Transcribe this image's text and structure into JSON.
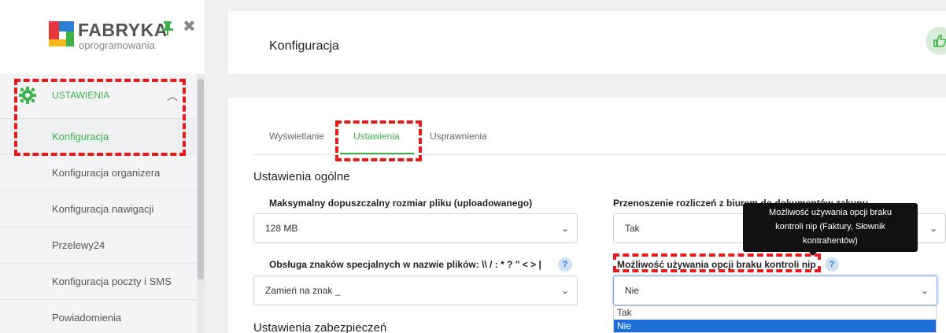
{
  "logo": {
    "title": "FABRYKA",
    "subtitle": "oprogramowania"
  },
  "sidebar": {
    "section_label": "USTAWIENIA",
    "items": [
      {
        "label": "Konfiguracja",
        "active": true
      },
      {
        "label": "Konfiguracja organizera"
      },
      {
        "label": "Konfiguracja nawigacji"
      },
      {
        "label": "Przelewy24"
      },
      {
        "label": "Konfiguracja poczty i SMS"
      },
      {
        "label": "Powiadomienia"
      }
    ]
  },
  "header": {
    "title": "Konfiguracja"
  },
  "tabs": [
    {
      "label": "Wyświetlanie"
    },
    {
      "label": "Ustawienia",
      "active": true
    },
    {
      "label": "Usprawnienia"
    }
  ],
  "general": {
    "heading": "Ustawienia ogólne",
    "max_file_label": "Maksymalny dopuszczalny rozmiar pliku (uploadowanego)",
    "max_file_value": "128 MB",
    "transfer_label": "Przenoszenie rozliczeń z biurem do dokumentów zakupu",
    "transfer_value": "Tak",
    "special_chars_label": "Obsługa znaków specjalnych w nazwie plików: \\\\ / : * ? \" < > |",
    "special_chars_value": "Zamień na znak _",
    "nip_label": "Możliwość używania opcji braku kontroli nip",
    "nip_value": "Nie",
    "nip_options": [
      "Tak",
      "Nie"
    ],
    "help_glyph": "?"
  },
  "tooltip": {
    "line1": "Możliwość używania opcji braku",
    "line2": "kontroli nip (Faktury, Słownik",
    "line3": "kontrahentów)"
  },
  "security": {
    "heading": "Ustawienia zabezpieczeń"
  },
  "icons": {
    "gear": "gear-icon",
    "pin": "pin-icon",
    "close": "close-icon",
    "thumb": "thumbs-up-icon",
    "chevron": "chevron-down-icon"
  },
  "colors": {
    "accent": "#3db24a",
    "highlight": "#e21b1b",
    "selected": "#1e6fd9"
  }
}
